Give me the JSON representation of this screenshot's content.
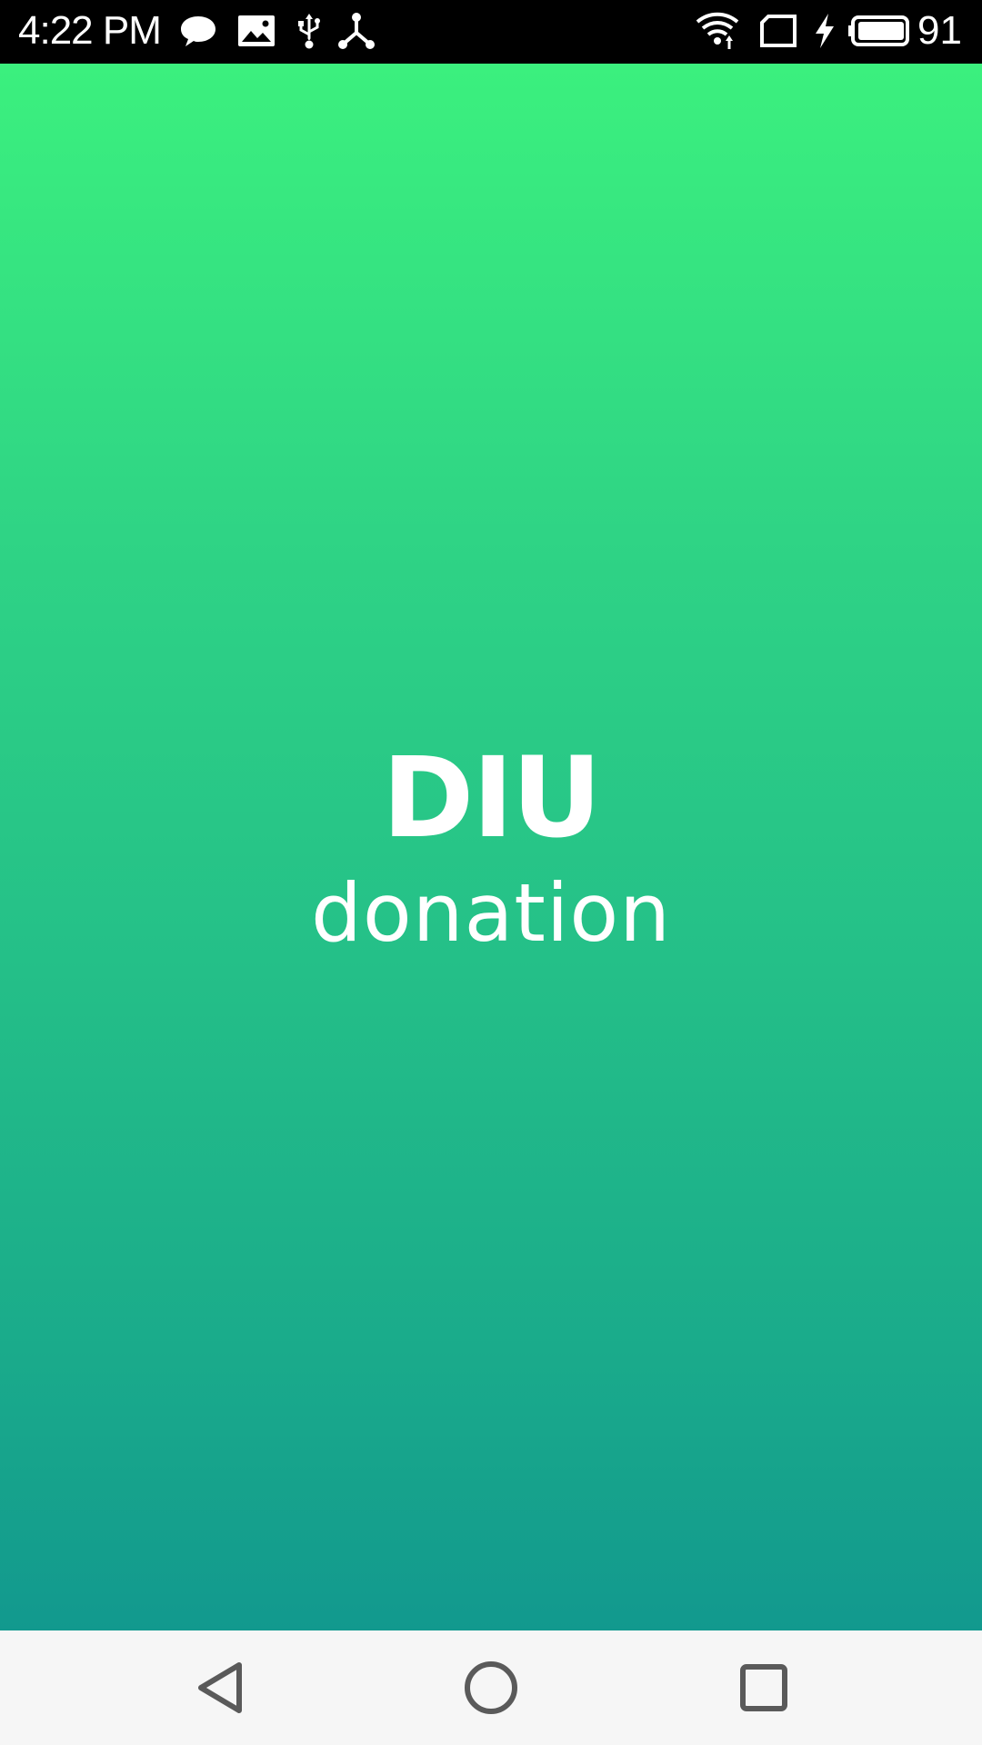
{
  "status_bar": {
    "time": "4:22 PM",
    "battery_level": "91",
    "icons": [
      "chat-icon",
      "image-icon",
      "usb-icon",
      "share-node-icon",
      "wifi-icon",
      "sim-card-icon",
      "charging-icon",
      "battery-icon"
    ]
  },
  "splash": {
    "title": "DIU",
    "subtitle": "donation",
    "gradient_top": "#3bf07e",
    "gradient_bottom": "#12998e"
  },
  "nav_bar": {
    "buttons": [
      "back-icon",
      "home-icon",
      "recents-icon"
    ]
  }
}
